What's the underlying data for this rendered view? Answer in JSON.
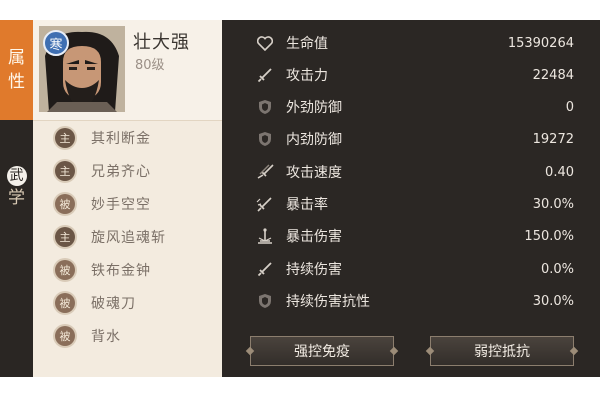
{
  "tabs": [
    {
      "first": "属",
      "second": "性",
      "active": true
    },
    {
      "first": "武",
      "second": "学",
      "active": false
    }
  ],
  "character": {
    "name": "壮大强",
    "level": "80级",
    "status_badge": "寒"
  },
  "skills": [
    {
      "badge": "主",
      "name": "其利断金"
    },
    {
      "badge": "主",
      "name": "兄弟齐心"
    },
    {
      "badge": "被",
      "name": "妙手空空"
    },
    {
      "badge": "主",
      "name": "旋风追魂斩"
    },
    {
      "badge": "被",
      "name": "铁布金钟"
    },
    {
      "badge": "被",
      "name": "破魂刀"
    },
    {
      "badge": "被",
      "name": "背水"
    }
  ],
  "stats": [
    {
      "icon": "heart-icon",
      "label": "生命值",
      "value": "15390264"
    },
    {
      "icon": "sword-icon",
      "label": "攻击力",
      "value": "22484"
    },
    {
      "icon": "shield-icon",
      "label": "外劲防御",
      "value": "0"
    },
    {
      "icon": "shield-icon",
      "label": "内劲防御",
      "value": "19272"
    },
    {
      "icon": "twin-swords-icon",
      "label": "攻击速度",
      "value": "0.40"
    },
    {
      "icon": "crit-icon",
      "label": "暴击率",
      "value": "30.0%"
    },
    {
      "icon": "anchor-icon",
      "label": "暴击伤害",
      "value": "150.0%"
    },
    {
      "icon": "sword-icon",
      "label": "持续伤害",
      "value": "0.0%"
    },
    {
      "icon": "shield-icon",
      "label": "持续伤害抗性",
      "value": "30.0%"
    }
  ],
  "buttons": {
    "control_immunity": "强控免疫",
    "weak_control_resist": "弱控抵抗"
  },
  "colors": {
    "accent": "#e07a2c",
    "panel_dark": "#2b2724",
    "panel_light": "#f3ebdf"
  }
}
